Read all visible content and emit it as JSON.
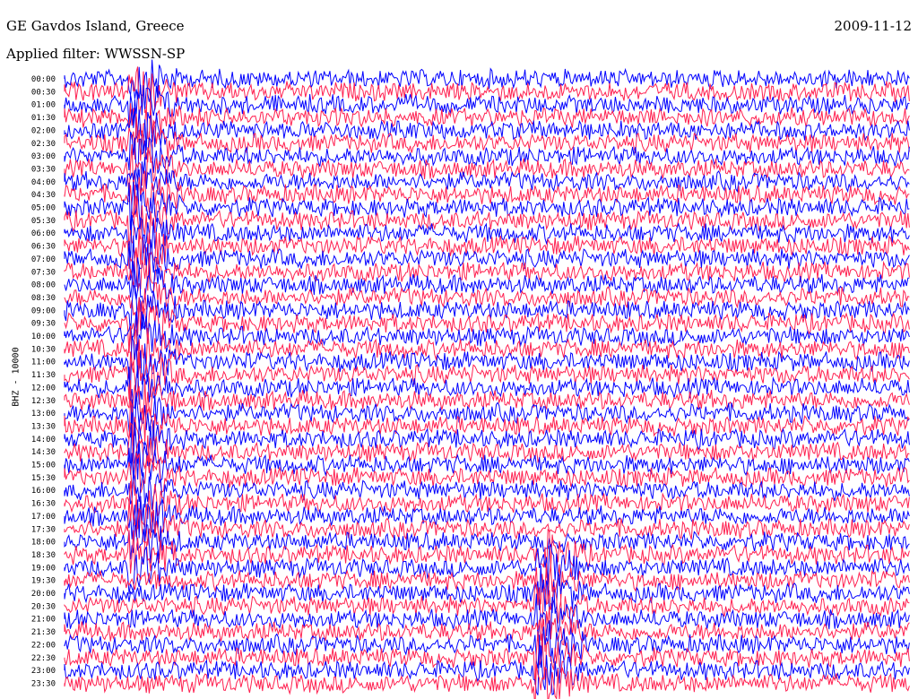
{
  "header": {
    "station": "GE Gavdos Island, Greece",
    "date": "2009-11-12",
    "filter": "Applied filter: WWSSN-SP"
  },
  "chart_data": {
    "type": "line",
    "title": "GE Gavdos Island, Greece",
    "ylabel": "BHZ - 10000",
    "row_labels": [
      "00:00",
      "00:30",
      "01:00",
      "01:30",
      "02:00",
      "02:30",
      "03:00",
      "03:30",
      "04:00",
      "04:30",
      "05:00",
      "05:30",
      "06:00",
      "06:30",
      "07:00",
      "07:30",
      "08:00",
      "08:30",
      "09:00",
      "09:30",
      "10:00",
      "10:30",
      "11:00",
      "11:30",
      "12:00",
      "12:30",
      "13:00",
      "13:30",
      "14:00",
      "14:30",
      "15:00",
      "15:30",
      "16:00",
      "16:30",
      "17:00",
      "17:30",
      "18:00",
      "18:30",
      "19:00",
      "19:30",
      "20:00",
      "20:30",
      "21:00",
      "21:30",
      "22:00",
      "22:30",
      "23:00",
      "23:30"
    ],
    "trace_colors": [
      "#0000ff",
      "#ff2050"
    ],
    "grid": false,
    "events": [
      {
        "start_row": "00:00",
        "end_row": "19:00",
        "x_fraction": 0.08
      },
      {
        "start_row": "18:30",
        "end_row": "23:30",
        "x_fraction": 0.56
      }
    ]
  }
}
